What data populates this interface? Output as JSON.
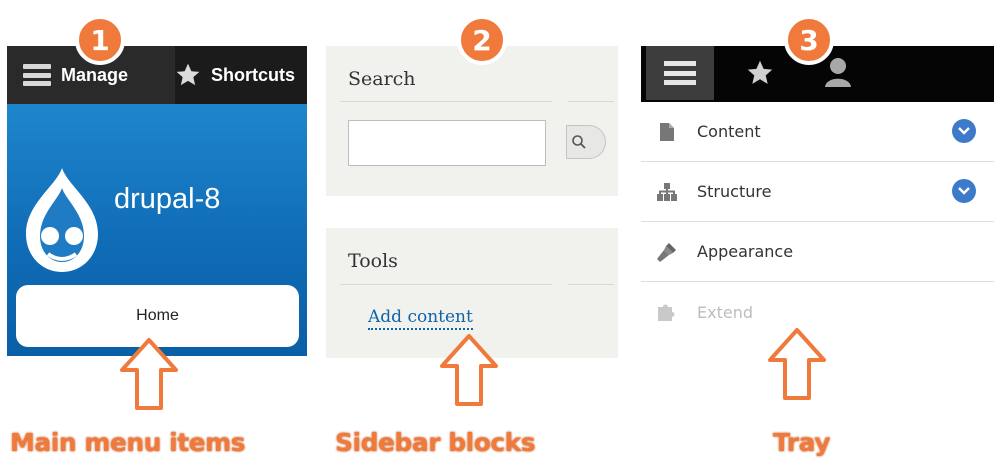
{
  "panel1": {
    "manage_label": "Manage",
    "shortcuts_label": "Shortcuts",
    "site_name": "drupal-8",
    "home_label": "Home",
    "header_color": "#0f6cb6"
  },
  "panel2": {
    "search_title": "Search",
    "search_value": "",
    "tools_title": "Tools",
    "add_content_link": "Add content"
  },
  "panel3": {
    "tray_items": [
      {
        "label": "Content",
        "icon": "file-icon",
        "expandable": true
      },
      {
        "label": "Structure",
        "icon": "structure-icon",
        "expandable": true
      },
      {
        "label": "Appearance",
        "icon": "paintbrush-icon",
        "expandable": false
      },
      {
        "label": "Extend",
        "icon": "puzzle-icon",
        "expandable": false
      }
    ]
  },
  "callouts": {
    "badges": [
      "1",
      "2",
      "3"
    ],
    "captions": [
      "Main menu items",
      "Sidebar blocks",
      "Tray"
    ],
    "accent_color": "#ef7a3c"
  }
}
